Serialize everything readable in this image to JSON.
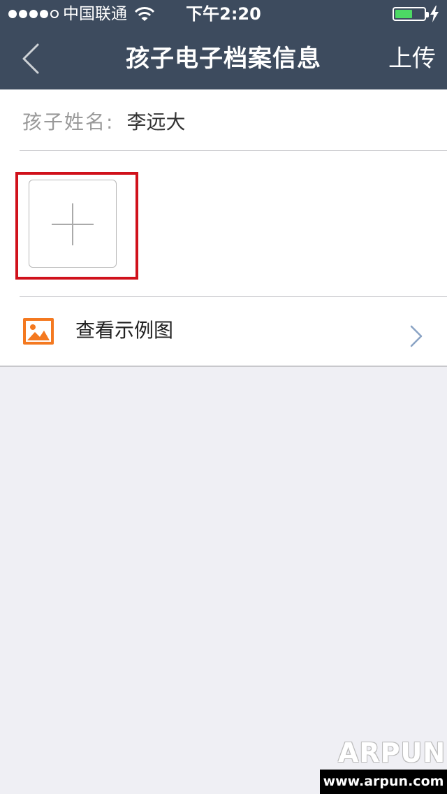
{
  "status_bar": {
    "carrier": "中国联通",
    "time": "下午2:20",
    "signal_bars_filled": 4,
    "signal_bars_total": 5,
    "battery_level": 0.6
  },
  "nav": {
    "title": "孩子电子档案信息",
    "upload_label": "上传",
    "back_icon": "chevron-left-icon"
  },
  "form": {
    "name_label": "孩子姓名:",
    "name_value": "李远大"
  },
  "add_photo_icon": "plus-icon",
  "example": {
    "label": "查看示例图",
    "icon": "image-icon",
    "icon_color": "#f47920"
  },
  "watermark": {
    "logo": "ARPUN",
    "url": "www.arpun.com"
  },
  "colors": {
    "nav_background": "#3d4b5e",
    "highlight_border": "#d0111b",
    "battery_fill": "#4cd964",
    "page_background": "#efeff4",
    "chevron": "#8aa3c4"
  }
}
